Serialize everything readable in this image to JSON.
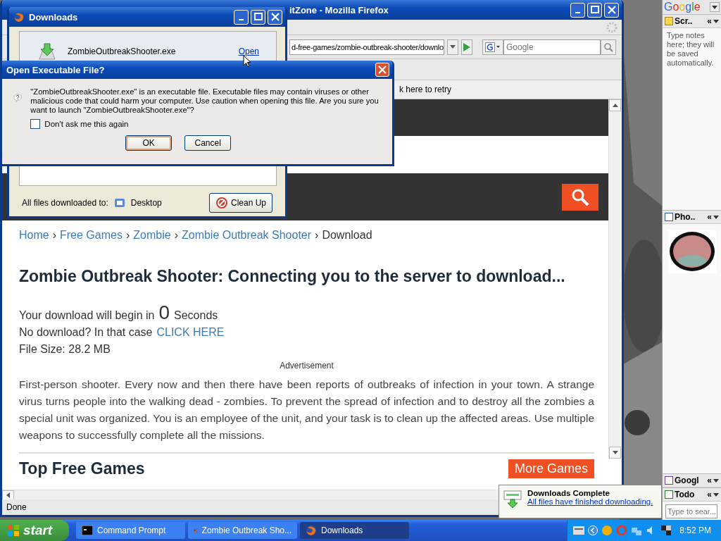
{
  "firefox": {
    "title": "itZone - Mozilla Firefox",
    "url": "d-free-games/zombie-outbreak-shooter/downlo",
    "search_placeholder": "Google",
    "info_bar": "k here to retry",
    "status": "Done",
    "page": {
      "breadcrumb": [
        {
          "label": "Home",
          "kind": "link"
        },
        {
          "label": "›",
          "kind": "separator"
        },
        {
          "label": "Free Games",
          "kind": "link"
        },
        {
          "label": "›",
          "kind": "separator"
        },
        {
          "label": "Zombie",
          "kind": "link"
        },
        {
          "label": "›",
          "kind": "separator"
        },
        {
          "label": "Zombie Outbreak Shooter",
          "kind": "link"
        },
        {
          "label": "›",
          "kind": "separator"
        },
        {
          "label": "Download",
          "kind": "current"
        }
      ],
      "heading": "Zombie Outbreak Shooter: Connecting you to the server to download...",
      "countdown": {
        "prefix": "Your download will begin in",
        "number": "0",
        "suffix": "Seconds"
      },
      "no_download": {
        "text": "No download? In that case",
        "link": "CLICK HERE"
      },
      "file_size": "File Size: 28.2 MB",
      "advertisement": "Advertisement",
      "description": "First-person shooter. Every now and then there have been reports of outbreaks of infection in your town. A strange virus turns people into the walking dead - zombies. To prevent the spread of infection and to destroy all the zombies a special unit was organized. You is an employee of the unit, and your task is to clean up the affected areas. Use multiple weapons to successfully complete all the missions.",
      "section_title": "Top Free Games",
      "more_button": "More Games"
    }
  },
  "downloads_window": {
    "title": "Downloads",
    "items": [
      {
        "file": "ZombieOutbreakShooter.exe",
        "action": "Open"
      }
    ],
    "footer_label": "All files downloaded to:",
    "folder": "Desktop",
    "cleanup_button": "Clean Up"
  },
  "dialog": {
    "title": "Open Executable File?",
    "message": "\"ZombieOutbreakShooter.exe\" is an executable file. Executable files may contain viruses or other malicious code that could harm your computer. Use caution when opening this file. Are you sure you want to launch \"ZombieOutbreakShooter.exe\"?",
    "checkbox": {
      "label": "Don't ask me this again",
      "checked": false
    },
    "buttons": [
      {
        "label": "OK",
        "default": true
      },
      {
        "label": "Cancel",
        "default": false
      }
    ]
  },
  "sidebar": {
    "logo": "Google",
    "panels": [
      {
        "title": "Scr..",
        "kind": "notes",
        "text": "Type notes here; they will be saved automatically."
      },
      {
        "title": "Pho..",
        "kind": "photos"
      },
      {
        "title": "Googl",
        "kind": "collapsed"
      },
      {
        "title": "Todo",
        "kind": "todo",
        "placeholder": "Type to sear..."
      }
    ],
    "collapse": "«"
  },
  "notification": {
    "title": "Downloads Complete",
    "link": "All files have finished downloading."
  },
  "taskbar": {
    "start": "start",
    "tasks": [
      {
        "label": "Command Prompt",
        "selected": false
      },
      {
        "label": "Zombie Outbreak Sho...",
        "selected": false
      },
      {
        "label": "Downloads",
        "selected": true
      }
    ],
    "clock": "8:52 PM"
  }
}
